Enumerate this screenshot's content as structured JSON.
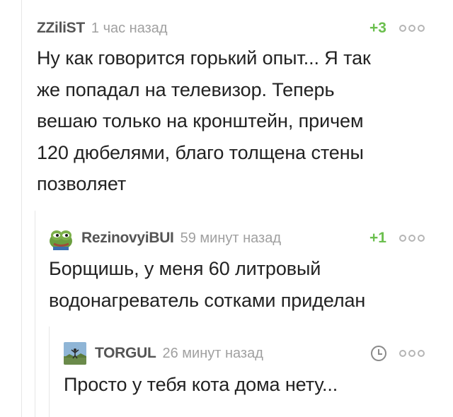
{
  "comments": [
    {
      "author": "ZZiliST",
      "time": "1 час назад",
      "rating": "+3",
      "lines": [
        "Ну как говорится горький опыт... Я так",
        "же попадал на телевизор. Теперь",
        "вешаю только на кронштейн, причем",
        "120 дюбелями, благо толщена стены",
        "позволяет"
      ]
    },
    {
      "author": "RezinovyiBUI",
      "time": "59 минут назад",
      "rating": "+1",
      "avatar_icon": "pepe-frog-avatar",
      "lines": [
        "Борщишь, у меня 60 литровый",
        "водонагреватель сотками приделан"
      ]
    },
    {
      "author": "TORGUL",
      "time": "26 минут назад",
      "avatar_icon": "landscape-photo-avatar",
      "status_icon": "clock-icon",
      "lines": [
        "Просто у тебя кота дома нету..."
      ]
    }
  ],
  "colors": {
    "author": "#555555",
    "time": "#a0a0a0",
    "rating_positive": "#6bbf4e",
    "thread_line": "#e6e6e6"
  }
}
